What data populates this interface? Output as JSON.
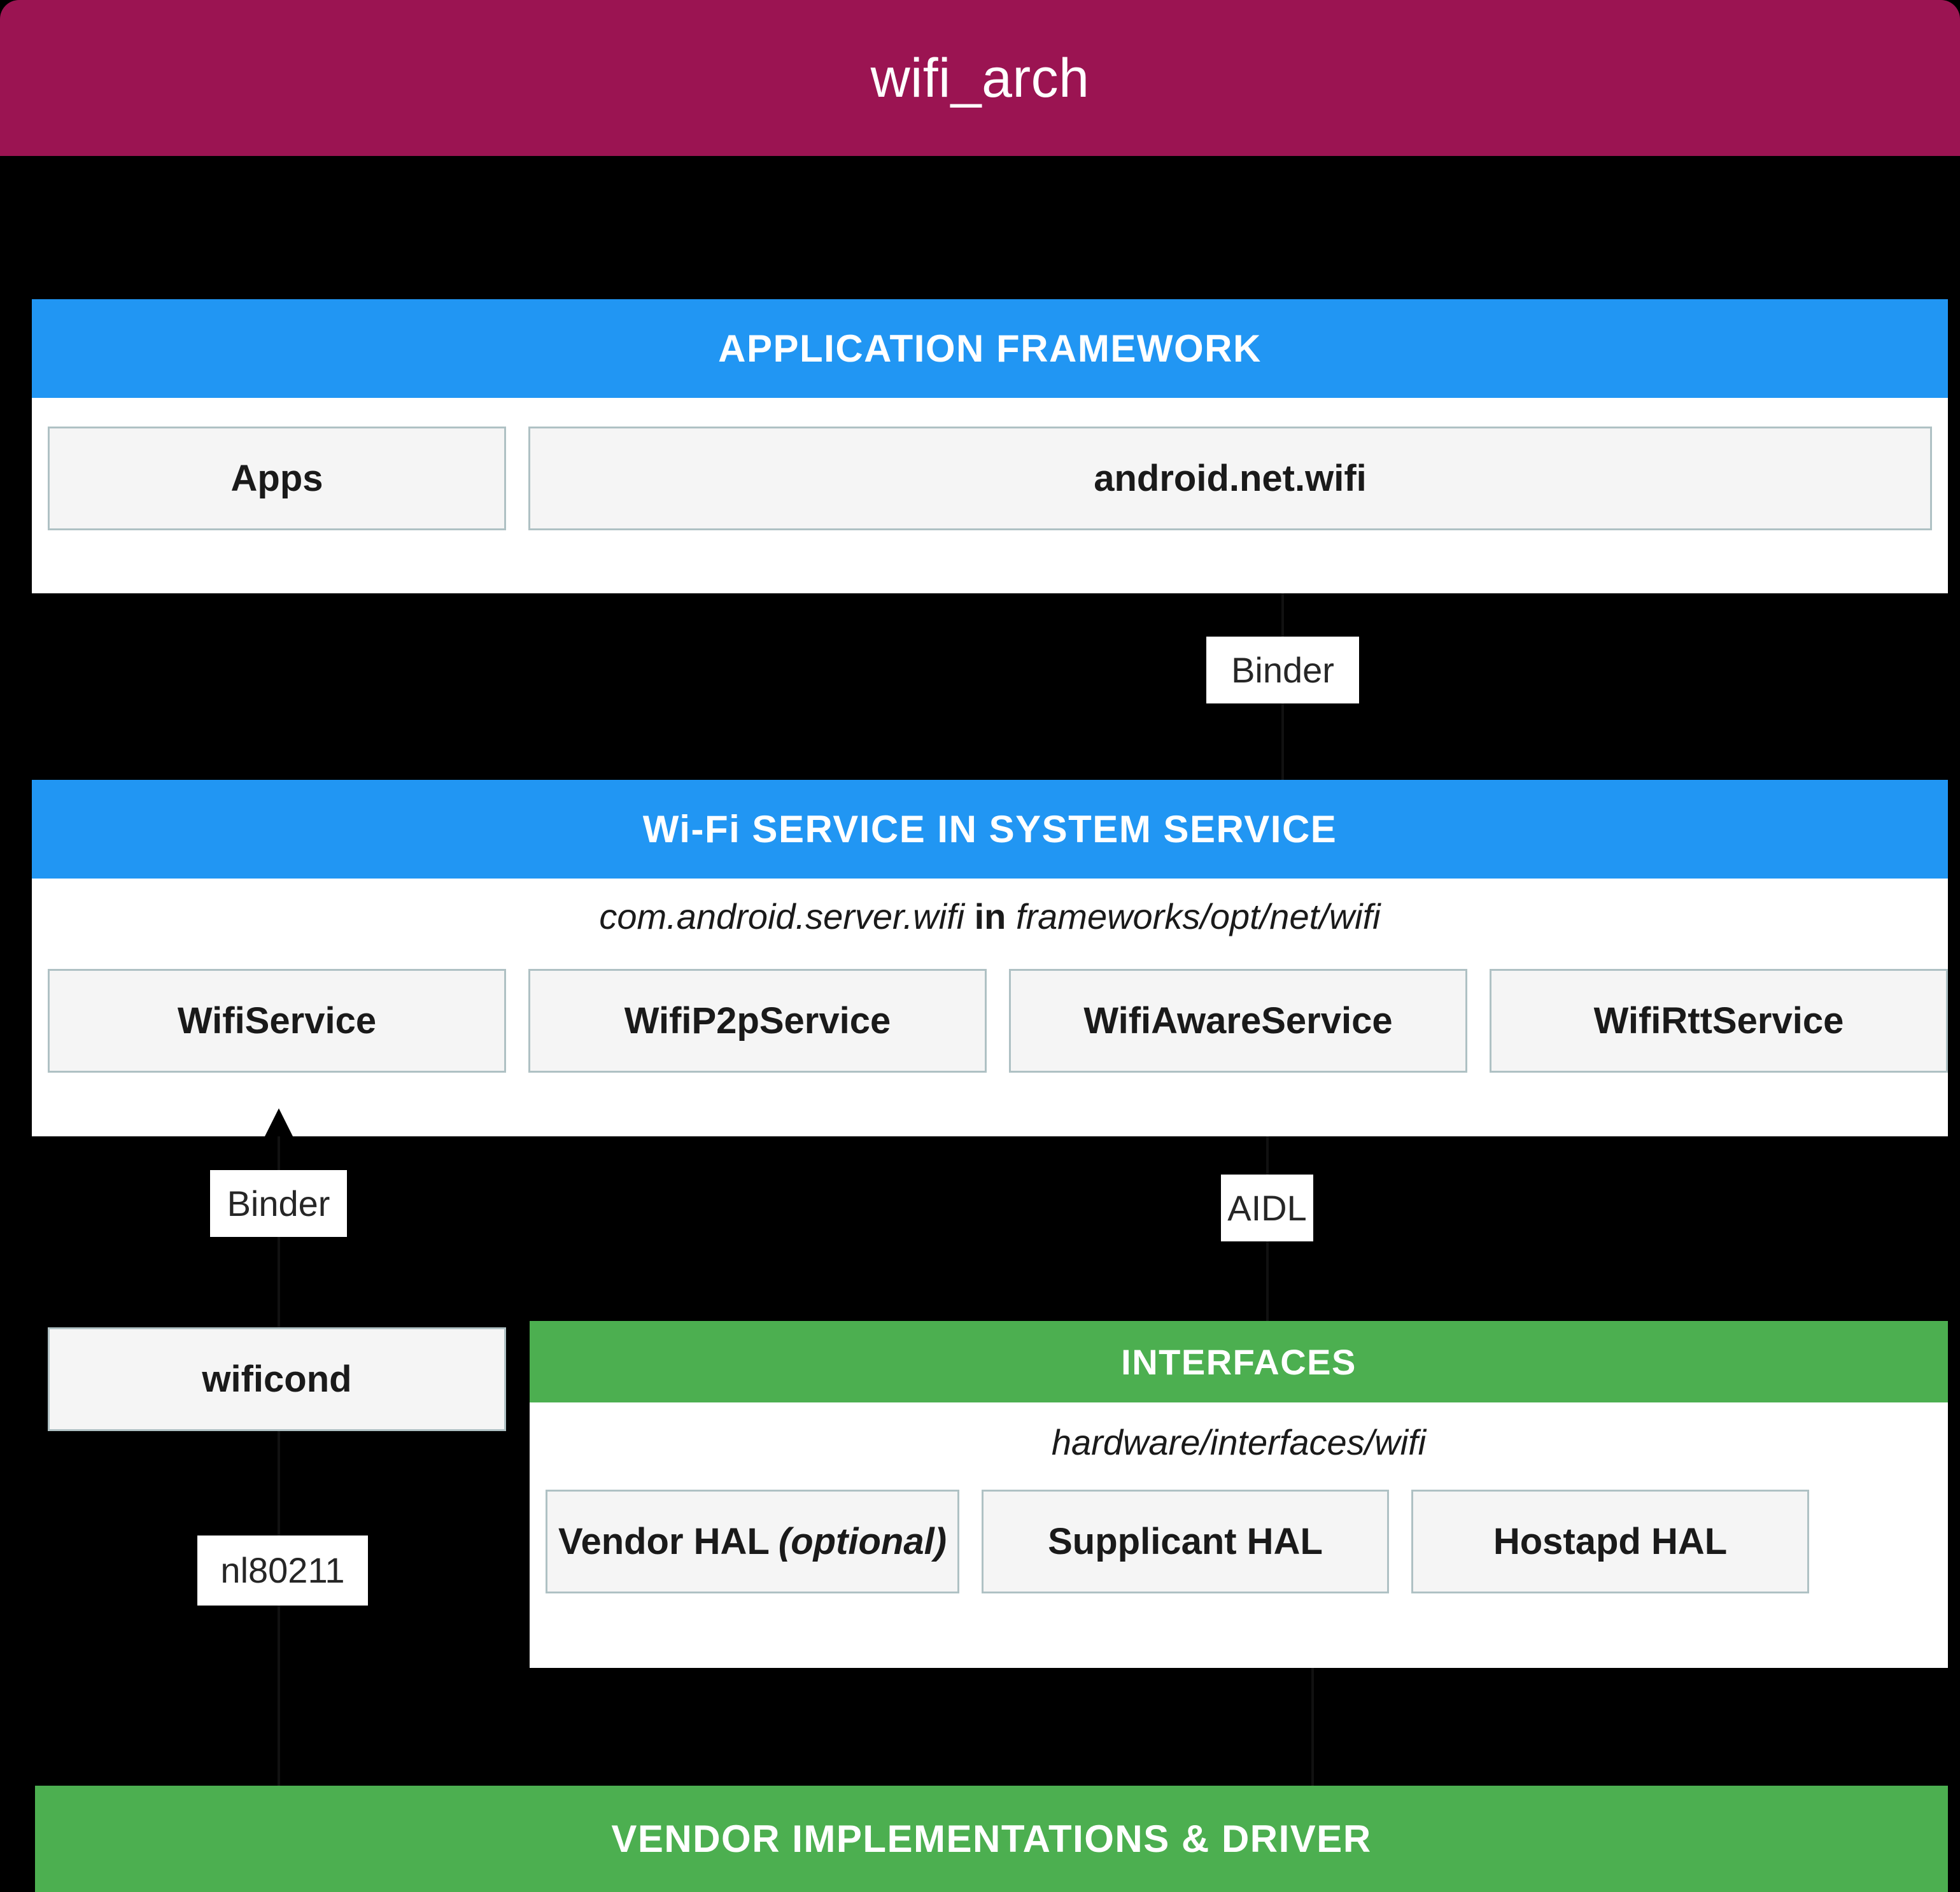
{
  "title": "wifi_arch",
  "colors": {
    "header": "#9B1452",
    "band_blue": "#2196F3",
    "band_green": "#4CAF50",
    "canvas": "#000000",
    "chip_fill": "#F5F5F5",
    "chip_border": "#AFC1C4"
  },
  "application_framework": {
    "band_label": "APPLICATION FRAMEWORK",
    "boxes": [
      {
        "label": "Apps"
      },
      {
        "label": "android.net.wifi"
      }
    ]
  },
  "connectors": {
    "framework_to_service": "Binder",
    "service_to_wificond": "Binder",
    "service_to_interfaces": "AIDL",
    "wificond_to_vendor": "nl80211"
  },
  "wifi_service": {
    "band_label": "Wi-Fi SERVICE IN SYSTEM SERVICE",
    "path_prefix": "com.android.server.wifi",
    "path_join": "in",
    "path_suffix": "frameworks/opt/net/wifi",
    "boxes": [
      {
        "label": "WifiService"
      },
      {
        "label": "WifiP2pService"
      },
      {
        "label": "WifiAwareService"
      },
      {
        "label": "WifiRttService"
      }
    ]
  },
  "wificond": {
    "label": "wificond"
  },
  "interfaces": {
    "band_label": "INTERFACES",
    "path": "hardware/interfaces/wifi",
    "boxes": [
      {
        "label": "Vendor HAL",
        "suffix": "(optional)"
      },
      {
        "label": "Supplicant HAL",
        "suffix": ""
      },
      {
        "label": "Hostapd HAL",
        "suffix": ""
      }
    ]
  },
  "vendor": {
    "band_label": "VENDOR IMPLEMENTATIONS & DRIVER"
  }
}
